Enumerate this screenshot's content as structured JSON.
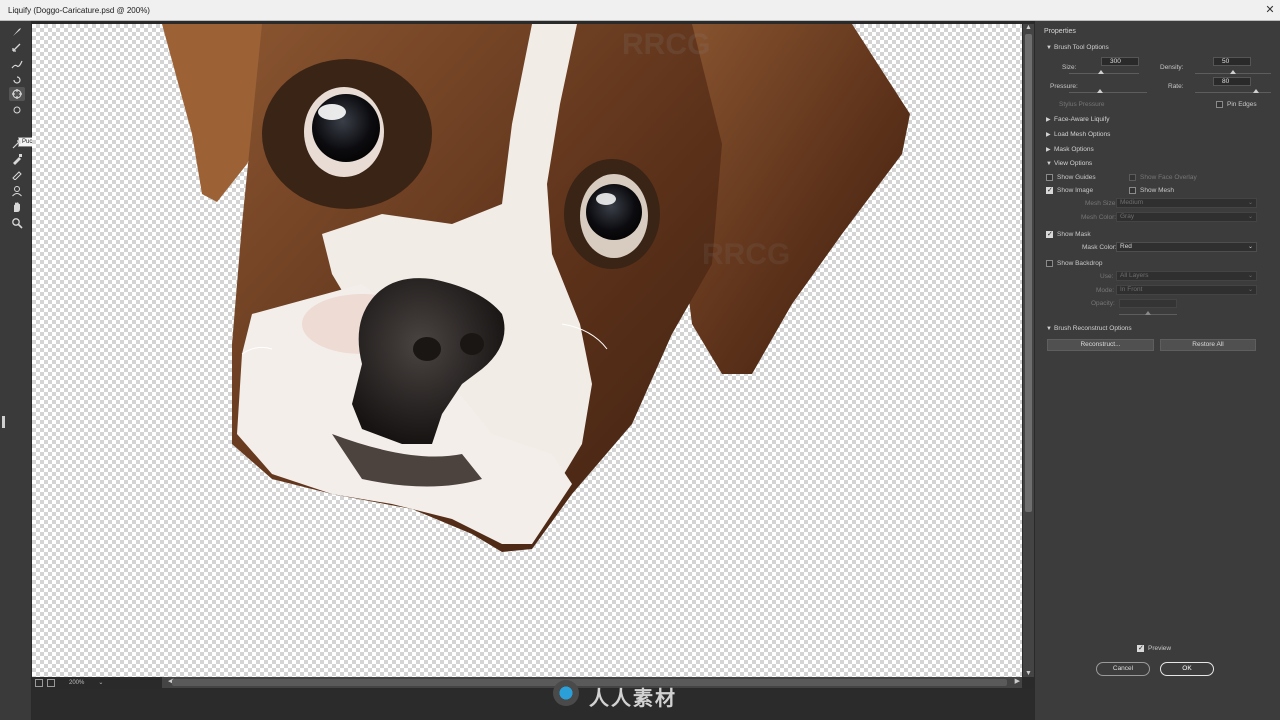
{
  "window": {
    "title": "Liquify (Doggo-Caricature.psd @ 200%)",
    "close_glyph": "✕"
  },
  "toolbar": {
    "tools": [
      {
        "name": "forward-warp-tool-icon"
      },
      {
        "name": "reconstruct-tool-icon"
      },
      {
        "name": "smooth-tool-icon"
      },
      {
        "name": "twirl-clockwise-tool-icon"
      },
      {
        "name": "pucker-tool-icon",
        "active": true
      },
      {
        "name": "bloat-tool-icon"
      },
      {
        "name": "push-left-tool-icon"
      },
      {
        "name": "freeze-mask-tool-icon"
      },
      {
        "name": "thaw-mask-tool-icon"
      },
      {
        "name": "face-tool-icon"
      },
      {
        "name": "hand-tool-icon"
      },
      {
        "name": "zoom-tool-icon"
      }
    ],
    "tooltip": "Pucker Tool (S)"
  },
  "status": {
    "zoom": "200%"
  },
  "properties": {
    "title": "Properties",
    "brush_tool_options": {
      "header": "Brush Tool Options",
      "size_label": "Size:",
      "size_value": "300",
      "density_label": "Density:",
      "density_value": "50",
      "pressure_label": "Pressure:",
      "rate_label": "Rate:",
      "rate_value": "80",
      "stylus_pressure_label": "Stylus Pressure",
      "pin_edges_label": "Pin Edges",
      "size_slider_fraction": 0.45,
      "density_slider_fraction": 0.5,
      "pressure_slider_fraction": 0.4,
      "rate_slider_fraction": 0.8
    },
    "face_aware_liquify": "Face-Aware Liquify",
    "load_mesh_options": "Load Mesh Options",
    "mask_options": "Mask Options",
    "view_options": {
      "header": "View Options",
      "show_guides": "Show Guides",
      "show_face_overlay": "Show Face Overlay",
      "show_image": "Show Image",
      "show_mesh": "Show Mesh",
      "mesh_size_label": "Mesh Size:",
      "mesh_size_value": "Medium",
      "mesh_color_label": "Mesh Color:",
      "mesh_color_value": "Gray",
      "show_mask": "Show Mask",
      "mask_color_label": "Mask Color:",
      "mask_color_value": "Red",
      "show_backdrop": "Show Backdrop",
      "use_label": "Use:",
      "use_value": "All Layers",
      "mode_label": "Mode:",
      "mode_value": "In Front",
      "opacity_label": "Opacity:",
      "opacity_slider_fraction": 0.5
    },
    "brush_reconstruct_options": {
      "header": "Brush Reconstruct Options",
      "reconstruct_button": "Reconstruct...",
      "restore_all_button": "Restore All"
    },
    "preview_label": "Preview",
    "cancel_button": "Cancel",
    "ok_button": "OK"
  },
  "watermark": {
    "text": "人人素材"
  },
  "colors": {
    "panel_bg": "#3c3c3c",
    "toolbar_bg": "#3a3a3a",
    "fur_brown": "#6b3e22",
    "fur_white": "#f2ece6",
    "nose": "#2a2624"
  }
}
